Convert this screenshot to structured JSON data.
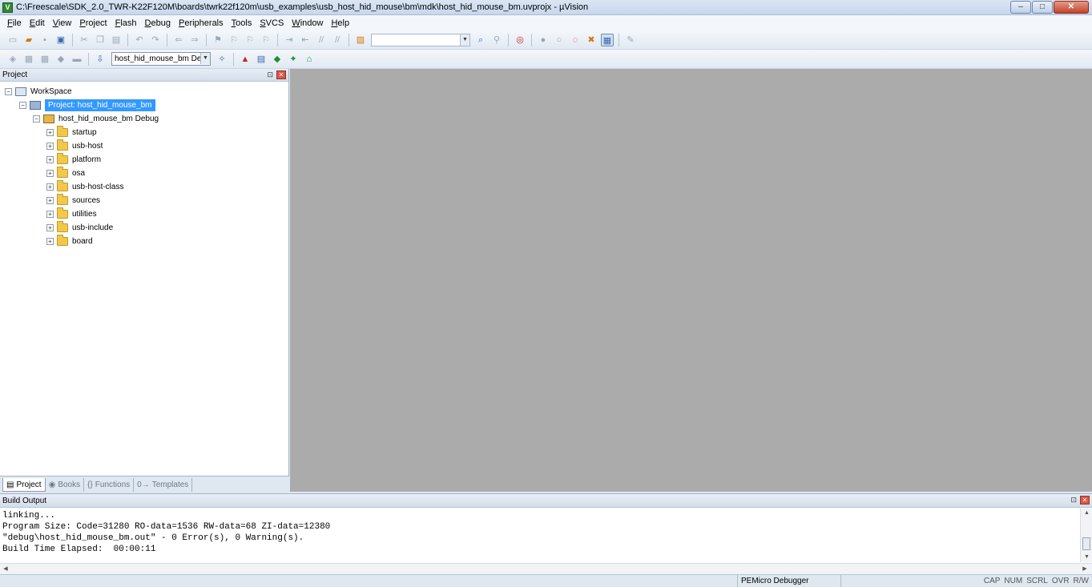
{
  "window": {
    "title": "C:\\Freescale\\SDK_2.0_TWR-K22F120M\\boards\\twrk22f120m\\usb_examples\\usb_host_hid_mouse\\bm\\mdk\\host_hid_mouse_bm.uvprojx - µVision",
    "app_icon_glyph": "V",
    "controls": {
      "minimize": "–",
      "maximize": "□",
      "close": "✕"
    }
  },
  "menu": [
    "File",
    "Edit",
    "View",
    "Project",
    "Flash",
    "Debug",
    "Peripherals",
    "Tools",
    "SVCS",
    "Window",
    "Help"
  ],
  "toolbar2": {
    "target_select": "host_hid_mouse_bm Debug"
  },
  "project_panel": {
    "title": "Project",
    "pin_glyph": "⊡",
    "close_glyph": "✕",
    "tree": {
      "workspace": "WorkSpace",
      "project": "Project: host_hid_mouse_bm",
      "target": "host_hid_mouse_bm Debug",
      "groups": [
        "startup",
        "usb-host",
        "platform",
        "osa",
        "usb-host-class",
        "sources",
        "utilities",
        "usb-include",
        "board"
      ]
    },
    "tabs": [
      {
        "label": "Project",
        "icon": "▤"
      },
      {
        "label": "Books",
        "icon": "◉"
      },
      {
        "label": "Functions",
        "icon": "{}"
      },
      {
        "label": "Templates",
        "icon": "0→"
      }
    ]
  },
  "build_output": {
    "title": "Build Output",
    "lines": [
      "linking...",
      "Program Size: Code=31280 RO-data=1536 RW-data=68 ZI-data=12380",
      "\"debug\\host_hid_mouse_bm.out\" - 0 Error(s), 0 Warning(s).",
      "Build Time Elapsed:  00:00:11"
    ]
  },
  "statusbar": {
    "debugger": "PEMicro Debugger",
    "indicators": [
      "CAP",
      "NUM",
      "SCRL",
      "OVR",
      "R/W"
    ]
  }
}
